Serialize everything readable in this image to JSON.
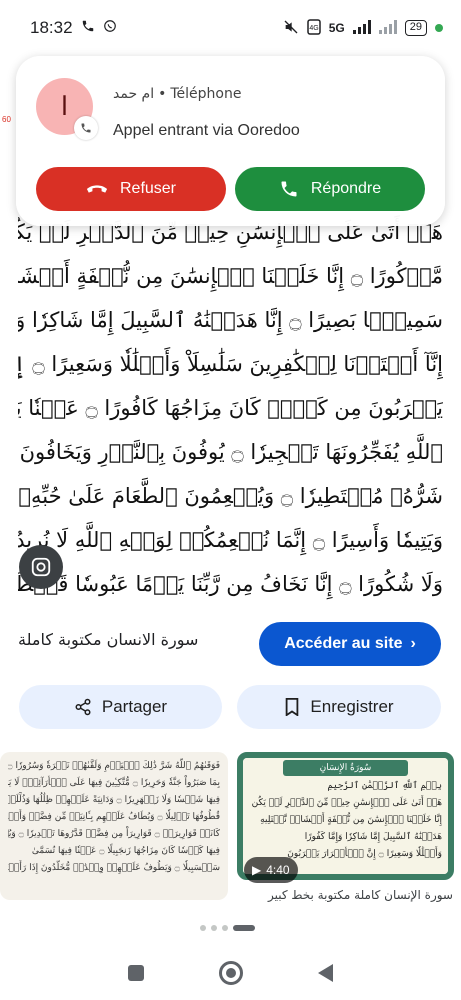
{
  "status": {
    "time": "18:32",
    "network": "5G",
    "battery": "29"
  },
  "call": {
    "caller_name": "ام حمد",
    "source": "Téléphone",
    "separator": "•",
    "subtitle": "Appel entrant via Ooredoo",
    "avatar_letter": "ا",
    "decline_label": "Refuser",
    "answer_label": "Répondre",
    "decline_color": "#d93025",
    "answer_color": "#1e8e3e"
  },
  "side_marker": "60",
  "quran_lines": [
    "هَلۡ أَتَىٰ عَلَى ٱلۡإِنسَٰنِ حِينٞ مِّنَ ٱلدَّهۡرِ لَمۡ يَكُن شَيۡـٔٗا",
    "مَّذۡكُورًا ۝ إِنَّا خَلَقۡنَا ٱلۡإِنسَٰنَ مِن نُّطۡفَةٍ أَمۡشَاجٖ نَّبۡتَلِيهِ فَجَعَلۡنَٰهُ",
    "سَمِيعَۢا بَصِيرًا ۝ إِنَّا هَدَيۡنَٰهُ ٱلسَّبِيلَ إِمَّا شَاكِرٗا وَإِمَّا كَفُورًا ۝",
    "إِنَّآ أَعۡتَدۡنَا لِلۡكَٰفِرِينَ سَلَٰسِلَاْ وَأَغۡلَٰلٗا وَسَعِيرًا ۝ إِنَّ ٱلۡأَبۡرَارَ",
    "يَشۡرَبُونَ مِن كَأۡسٖ كَانَ مِزَاجُهَا كَافُورًا ۝ عَيۡنٗا يَشۡرَبُ بِهَا عِبَادُ",
    "ٱللَّهِ يُفَجِّرُونَهَا تَفۡجِيرٗا ۝ يُوفُونَ بِٱلنَّذۡرِ وَيَخَافُونَ يَوۡمٗا كَانَ",
    "شَرُّهُۥ مُسۡتَطِيرٗا ۝ وَيُطۡعِمُونَ ٱلطَّعَامَ عَلَىٰ حُبِّهِۦ مِسۡكِينٗا",
    "وَيَتِيمٗا وَأَسِيرًا ۝ إِنَّمَا نُطۡعِمُكُمۡ لِوَجۡهِ ٱللَّهِ لَا نُرِيدُ مِنكُمۡ جَزَآءٗ",
    "وَلَا شُكُورًا ۝ إِنَّا نَخَافُ مِن رَّبِّنَا يَوۡمًا عَبُوسٗا قَمۡطَرِيرٗا"
  ],
  "result": {
    "title": "سورة الانسان مكتوبة كاملة",
    "visit_label": "Accéder au site",
    "share_label": "Partager",
    "save_label": "Enregistrer"
  },
  "related": {
    "thumb1_lines": [
      "فَوَقَىٰهُمُ ٱللَّهُ شَرَّ ذَٰلِكَ ٱلۡيَوۡمِ وَلَقَّىٰهُمۡ نَضۡرَةٗ وَسُرُورٗا ۝ وَجَزَىٰهُم",
      "بِمَا صَبَرُواْ جَنَّةٗ وَحَرِيرٗا ۝ مُّتَّكِـِٔينَ فِيهَا عَلَى ٱلۡأَرَآئِكِۖ لَا يَرَوۡنَ",
      "فِيهَا شَمۡسٗا وَلَا زَمۡهَرِيرٗا ۝ وَدَانِيَةً عَلَيۡهِمۡ ظِلَٰلُهَا وَذُلِّلَتۡ",
      "قُطُوفُهَا تَذۡلِيلٗا ۝ وَيُطَافُ عَلَيۡهِم بِـَٔانِيَةٖ مِّن فِضَّةٖ وَأَكۡوَابٖ",
      "كَانَتۡ قَوَارِيرَا۠ ۝ قَوَارِيرَاْ مِن فِضَّةٖ قَدَّرُوهَا تَقۡدِيرٗا ۝ وَيُسۡقَوۡنَ",
      "فِيهَا كَأۡسٗا كَانَ مِزَاجُهَا زَنجَبِيلًا ۝ عَيۡنٗا فِيهَا تُسَمَّىٰ",
      "سَلۡسَبِيلٗا ۝ وَيَطُوفُ عَلَيۡهِمۡ وِلۡدَٰنٞ مُّخَلَّدُونَ إِذَا رَأَيۡتَهُمۡ"
    ],
    "thumb2_header": "سُورَةُ الإِنسَانِ",
    "thumb2_lines": [
      "بِسۡمِ ٱللَّهِ ٱلرَّحۡمَٰنِ ٱلرَّحِيمِ",
      "هَلۡ أَتَىٰ عَلَى ٱلۡإِنسَٰنِ حِينٞ مِّنَ ٱلدَّهۡرِ لَمۡ يَكُن شَيۡـٔٗا",
      "إِنَّا خَلَقۡنَا ٱلۡإِنسَٰنَ مِن نُّطۡفَةٍ أَمۡشَاجٖ نَّبۡتَلِيهِ",
      "هَدَيۡنَٰهُ ٱلسَّبِيلَ إِمَّا شَاكِرٗا وَإِمَّا كَفُورًا",
      "وَأَغۡلَٰلٗا وَسَعِيرًا ۝ إِنَّ ٱلۡأَبۡرَارَ يَشۡرَبُونَ"
    ],
    "duration": "4:40",
    "caption": "سورة الإنسان كاملة مكتوبة بخط كبير"
  }
}
